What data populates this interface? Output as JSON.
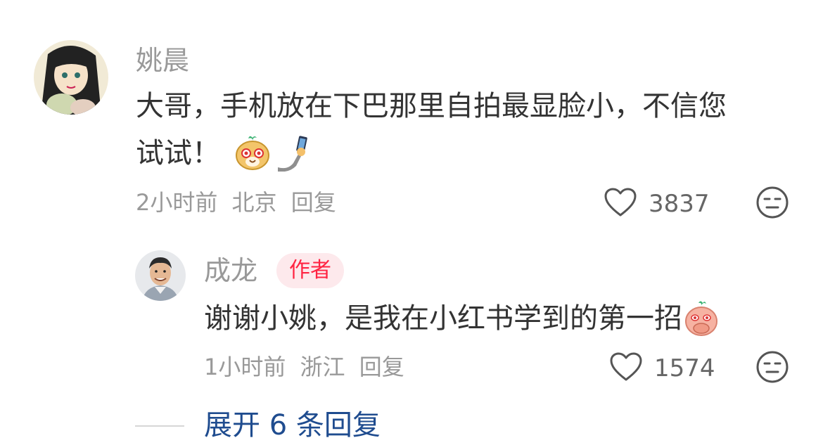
{
  "comment": {
    "username": "姚晨",
    "text_line1": "大哥，手机放在下巴那里自拍最显脸小，不信您",
    "text_line2": "试试！",
    "time": "2小时前",
    "location": "北京",
    "reply_label": "回复",
    "like_count": "3837",
    "emojis": [
      "xiaohongshu-smile-emoji",
      "selfie-emoji"
    ],
    "icons": [
      "heart-icon",
      "neutral-face-icon"
    ]
  },
  "reply": {
    "username": "成龙",
    "badge": "作者",
    "text": "谢谢小姚，是我在小红书学到的第一招",
    "time": "1小时前",
    "location": "浙江",
    "reply_label": "回复",
    "like_count": "1574",
    "emojis": [
      "xiaohongshu-cover-mouth-emoji"
    ],
    "icons": [
      "heart-icon",
      "neutral-face-icon"
    ]
  },
  "expand": {
    "label": "展开 6 条回复"
  },
  "colors": {
    "badge_text": "#ff2442",
    "badge_bg": "#fde9ec",
    "expand_link": "#1f4c8f",
    "muted": "#999999",
    "body_text": "#333333"
  }
}
